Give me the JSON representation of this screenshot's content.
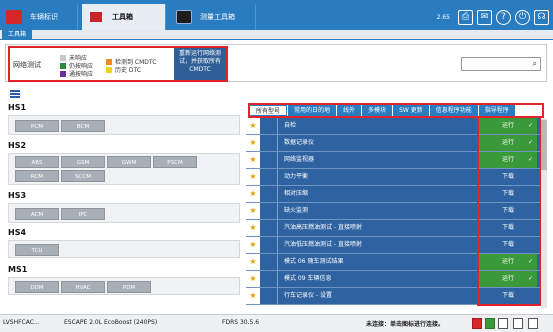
{
  "top_tabs": [
    {
      "label": "车辆标识",
      "icon": "car-icon"
    },
    {
      "label": "工具箱",
      "icon": "toolbox-icon"
    },
    {
      "label": "测量工具箱",
      "icon": "oscilloscope-icon"
    }
  ],
  "top_right": {
    "version": "2.65",
    "icons": [
      "printer-icon",
      "mail-icon",
      "help-icon",
      "power-icon",
      "wireless-icon"
    ]
  },
  "subtab": {
    "label": "工具箱"
  },
  "network_test": {
    "title": "网络测试",
    "legend": [
      {
        "label": "未响应",
        "color": "#c8c8c8"
      },
      {
        "label": "仍按响应",
        "color": "#2f8a3c"
      },
      {
        "label": "通按响应",
        "color": "#6a2e9a"
      },
      {
        "label": "检测到 CMDTC",
        "color": "#f08a1c"
      },
      {
        "label": "历史 DTC",
        "color": "#f2d21e"
      }
    ],
    "rerun_button": "重新运行网络测试，并获取所有 CMDTC",
    "search_placeholder": ""
  },
  "networks": [
    {
      "label": "HS1",
      "modules": [
        "PCM",
        "BCM"
      ]
    },
    {
      "label": "HS2",
      "modules": [
        "ABS",
        "GSM",
        "GWM",
        "PSCM",
        "RCM",
        "SCCM"
      ]
    },
    {
      "label": "HS3",
      "modules": [
        "ACM",
        "IPC"
      ]
    },
    {
      "label": "HS4",
      "modules": [
        "TCU"
      ]
    },
    {
      "label": "MS1",
      "modules": [
        "DDM",
        "HVAC",
        "PDM"
      ]
    }
  ],
  "category_tabs": [
    "所有型号",
    "常用的日的地",
    "线外",
    "多模块",
    "SW 更新",
    "信息程序功能",
    "指导程序"
  ],
  "tools": [
    {
      "name": "自检",
      "action": "运行",
      "status": "run"
    },
    {
      "name": "数据记录仪",
      "action": "运行",
      "status": "run"
    },
    {
      "name": "网络监视器",
      "action": "运行",
      "status": "run"
    },
    {
      "name": "动力平衡",
      "action": "下载",
      "status": "download"
    },
    {
      "name": "相对压缩",
      "action": "下载",
      "status": "download"
    },
    {
      "name": "缺火监测",
      "action": "下载",
      "status": "download"
    },
    {
      "name": "汽油高压燃油测试 - 直接喷射",
      "action": "下载",
      "status": "download"
    },
    {
      "name": "汽油低压燃油测试 - 直接喷射",
      "action": "下载",
      "status": "download"
    },
    {
      "name": "模式 06 随车测试结果",
      "action": "运行",
      "status": "run"
    },
    {
      "name": "模式 09 车辆信息",
      "action": "运行",
      "status": "run"
    },
    {
      "name": "行车记录仪 - 设置",
      "action": "下载",
      "status": "download"
    }
  ],
  "status_bar": {
    "vin": "LVSHFCAC...",
    "vehicle": "ESCAPE 2.0L EcoBoost (240PS)",
    "fdrs": "FDRS 30.5.6",
    "message": "未连接：单击图标进行连接。"
  },
  "colors": {
    "brand": "#2a7cc0",
    "row": "#2e62a0",
    "run": "#3a9a3a",
    "highlight": "#e0242a"
  }
}
